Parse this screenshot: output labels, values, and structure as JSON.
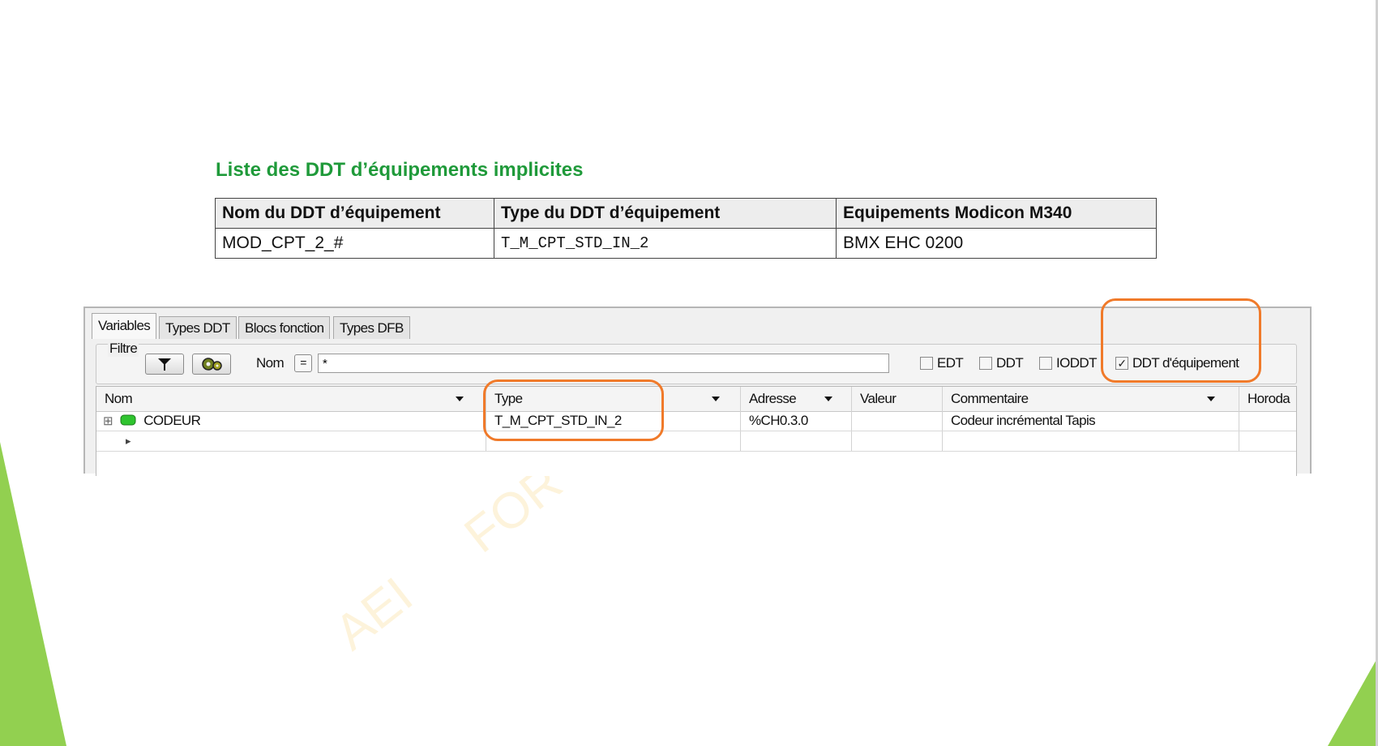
{
  "heading": "Liste des DDT d’équipements implicites",
  "ref_table": {
    "headers": [
      "Nom du DDT d’équipement",
      "Type du DDT d’équipement",
      "Equipements Modicon M340"
    ],
    "row": [
      "MOD_CPT_2_#",
      "T_M_CPT_STD_IN_2",
      "BMX EHC 0200"
    ]
  },
  "tabs": [
    "Variables",
    "Types DDT",
    "Blocs fonction",
    "Types DFB"
  ],
  "filter": {
    "label": "Filtre",
    "nom_label": "Nom",
    "eq_label": "=",
    "name_value": "*",
    "checkboxes": [
      {
        "label": "EDT",
        "checked": false
      },
      {
        "label": "DDT",
        "checked": false
      },
      {
        "label": "IODDT",
        "checked": false
      },
      {
        "label": "DDT d'équipement",
        "checked": true
      }
    ],
    "check_mark": "✓"
  },
  "grid": {
    "columns": [
      "Nom",
      "Type",
      "Adresse",
      "Valeur",
      "Commentaire",
      "Horoda"
    ],
    "rows": [
      {
        "expand": "⊞",
        "nom": "CODEUR",
        "type": "T_M_CPT_STD_IN_2",
        "adresse": "%CH0.3.0",
        "valeur": "",
        "commentaire": "Codeur incrémental Tapis",
        "horoda": ""
      }
    ],
    "new_row_marker": "▸"
  },
  "watermark": {
    "line1": "AEI",
    "line2": "FOR"
  },
  "colors": {
    "heading": "#1f9a3a",
    "highlight": "#f07a2a",
    "slide_accent": "#92d050",
    "device_icon": "#2fc42f"
  },
  "icons": {
    "filter_button": "funnel-icon",
    "settings_button": "gear-icon",
    "device": "device-icon"
  }
}
